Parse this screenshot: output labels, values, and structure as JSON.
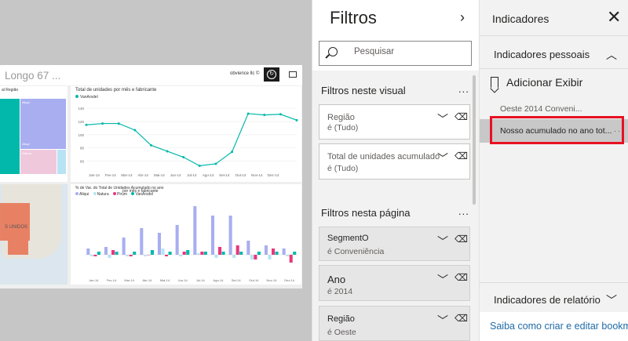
{
  "report": {
    "title": "Longo 67 ...",
    "brand": "obvience llc ©",
    "refresh_icon": "refresh-icon",
    "comment_icon": "comment-icon",
    "treemap": {
      "title": "al Região",
      "cells": [
        "Aliqui",
        "Aliqui",
        "Natura"
      ],
      "colors": [
        "#01b8aa",
        "#a8aef0",
        "#f0c8dc",
        "#b8e3f4"
      ]
    },
    "map": {
      "label": "S UNIDOS"
    },
    "line_chart": {
      "title": "Total de unidades por mês e fabricante",
      "legend": "VanArsdel"
    },
    "bar_chart": {
      "title": "% de Var. do Total de Unidades Acumulado no ano",
      "tooltip": "por mês e fabricante",
      "legend": [
        "Aliqui",
        "Natura",
        "Pirum",
        "VanArsdel"
      ]
    }
  },
  "chart_data": [
    {
      "type": "line",
      "title": "Total de unidades por mês e fabricante",
      "series": [
        {
          "name": "VanArsdel",
          "values": [
            115,
            117,
            117,
            107,
            84,
            75,
            66,
            53,
            56,
            74,
            132,
            130,
            131,
            122
          ]
        }
      ],
      "x": [
        "Jan-14",
        "Fev-14",
        "Mar-14",
        "Abr-14",
        "Mai-14",
        "Jun-14",
        "Jul-14",
        "Ago-14",
        "Set-14",
        "Out-14",
        "Nov-14",
        "Dez-14",
        "",
        ""
      ],
      "x_tick_labels": [
        "Jan-14",
        "Fev-14",
        "Mar-14",
        "Abr-14",
        "Mai-14",
        "Jun-14",
        "Jul-14",
        "Ago-14",
        "Set-14",
        "Out-14",
        "Nov-14",
        "Dez-14"
      ],
      "y_ticks": [
        60,
        80,
        100,
        120,
        140
      ],
      "ylim": [
        50,
        145
      ],
      "colors": {
        "VanArsdel": "#01b8aa"
      }
    },
    {
      "type": "bar",
      "title": "% de Var. do Total de Unidades Acumulado no ano",
      "categories": [
        "Jan-14",
        "Fev-14",
        "Mar-14",
        "Abr-14",
        "Mai-14",
        "Jun-14",
        "Jul-14",
        "Ago-14",
        "Set-14",
        "Out-14",
        "Nov-14",
        "Dez-14"
      ],
      "x_tick_labels": [
        "Jan-14",
        "Fev-14",
        "Mar-14",
        "Abr-14",
        "Mai-14",
        "Jun-14",
        "Jul-14",
        "Ago-14",
        "Set-14",
        "Out-14",
        "Nov-14",
        "Dez-14"
      ],
      "series": [
        {
          "name": "Aliqui",
          "values": [
            0.4,
            0.5,
            1.1,
            1.7,
            1.4,
            1.9,
            3.1,
            2.5,
            2.5,
            0.9,
            0.6,
            0.4
          ]
        },
        {
          "name": "Natura",
          "values": [
            -0.1,
            -0.2,
            -0.1,
            -0.1,
            0.4,
            -0.1,
            0.1,
            -0.2,
            -0.2,
            -0.3,
            -0.3,
            -0.1
          ]
        },
        {
          "name": "Pirum",
          "values": [
            -0.1,
            0.3,
            -0.1,
            0.0,
            -0.1,
            0.2,
            0.2,
            0.5,
            0.6,
            -0.3,
            0.4,
            -0.5
          ]
        },
        {
          "name": "VanArsdel",
          "values": [
            0.2,
            0.2,
            0.2,
            0.3,
            0.2,
            0.3,
            0.2,
            0.2,
            0.2,
            0.2,
            0.2,
            0.2
          ]
        }
      ],
      "ylim": [
        -1,
        3.5
      ],
      "colors": {
        "Aliqui": "#a8aef0",
        "Natura": "#b8e3f4",
        "Pirum": "#e8377d",
        "VanArsdel": "#01b8aa"
      }
    }
  ],
  "filters": {
    "title": "Filtros",
    "collapse_icon": "chevron-right-icon",
    "search_placeholder": "Pesquisar",
    "section_visual": "Filtros neste visual",
    "section_page": "Filtros nesta página",
    "more": "...",
    "visual_cards": [
      {
        "name": "Região",
        "value": "é (Tudo)"
      },
      {
        "name": "Total de unidades acumulado",
        "value": "é (Tudo)"
      }
    ],
    "page_cards": [
      {
        "name": "SegmentO",
        "value": "é Conveniência"
      },
      {
        "name": "Ano",
        "value": "é 2014"
      },
      {
        "name": "Região",
        "value": "é Oeste"
      }
    ]
  },
  "bookmarks": {
    "title": "Indicadores",
    "close": "✕",
    "personal": "Indicadores pessoais",
    "add": "Adicionar Exibir",
    "items": [
      "Oeste 2014 Conveni...",
      "Nosso acumulado no ano tot..."
    ],
    "item_more": "· · ·",
    "report_section": "Indicadores de relatório",
    "footer": "Saiba como criar e editar bookmarks",
    "highlight_color": "#e81123"
  }
}
